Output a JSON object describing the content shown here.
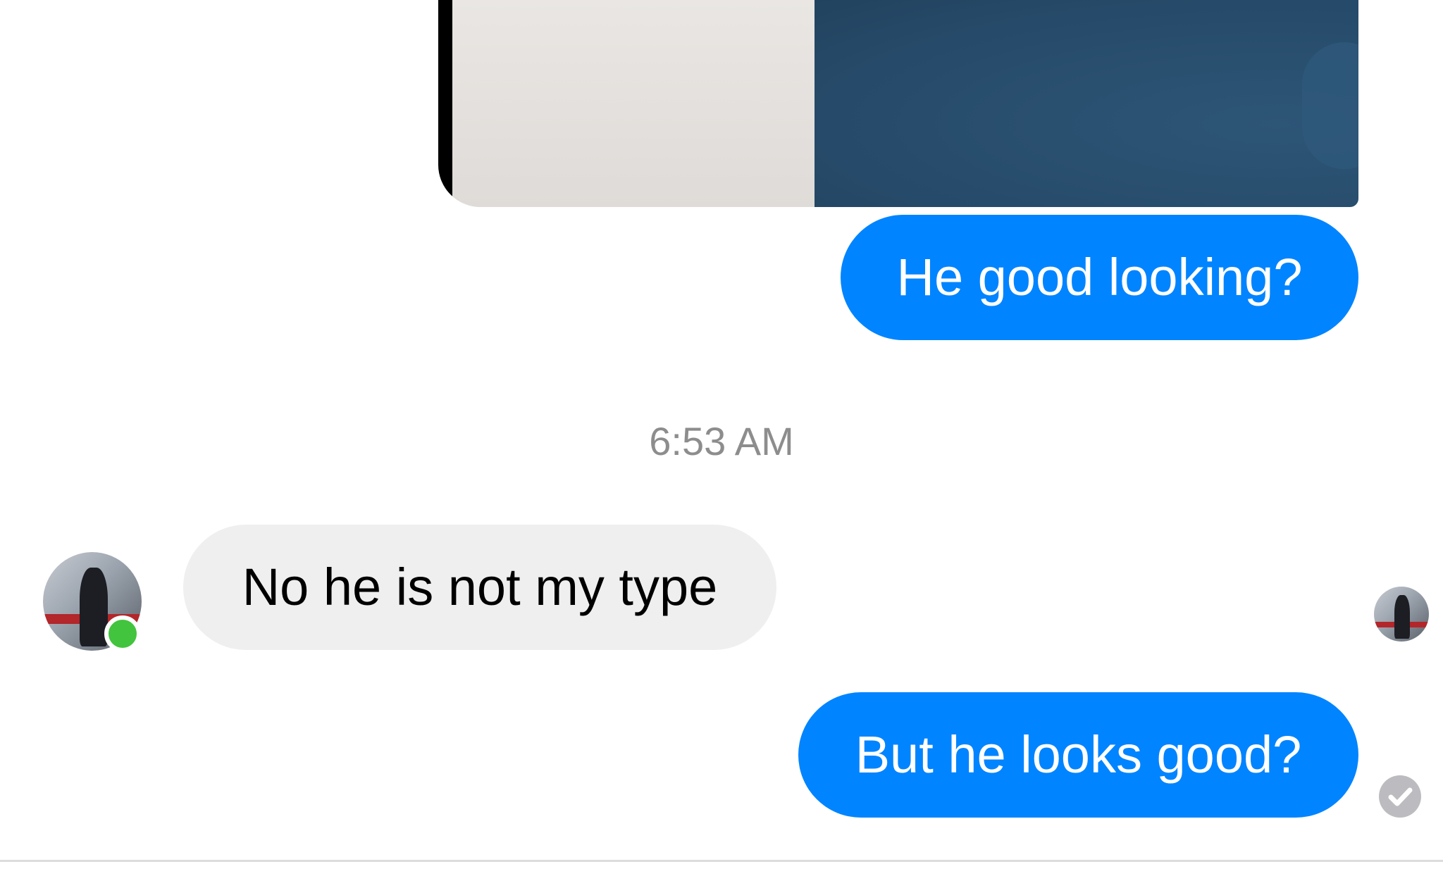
{
  "conversation": {
    "attachment": {
      "kind": "photo",
      "icon": "photo-attachment"
    },
    "messages": [
      {
        "sender": "me",
        "text": "He good looking?"
      },
      {
        "sender": "contact",
        "text": "No he is not my type"
      },
      {
        "sender": "me",
        "text": "But he looks good?"
      }
    ],
    "timestamp": "6:53 AM",
    "contact": {
      "status": "online",
      "avatar_icon": "avatar-photo"
    },
    "seen_indicator_icon": "avatar-photo",
    "delivery_status_icon": "check-circle-icon"
  },
  "colors": {
    "outgoing_bubble": "#0084ff",
    "incoming_bubble": "#efefef",
    "timestamp_text": "#8d8d8d",
    "online_dot": "#42c43e",
    "delivered_icon": "#bcbcc0"
  }
}
